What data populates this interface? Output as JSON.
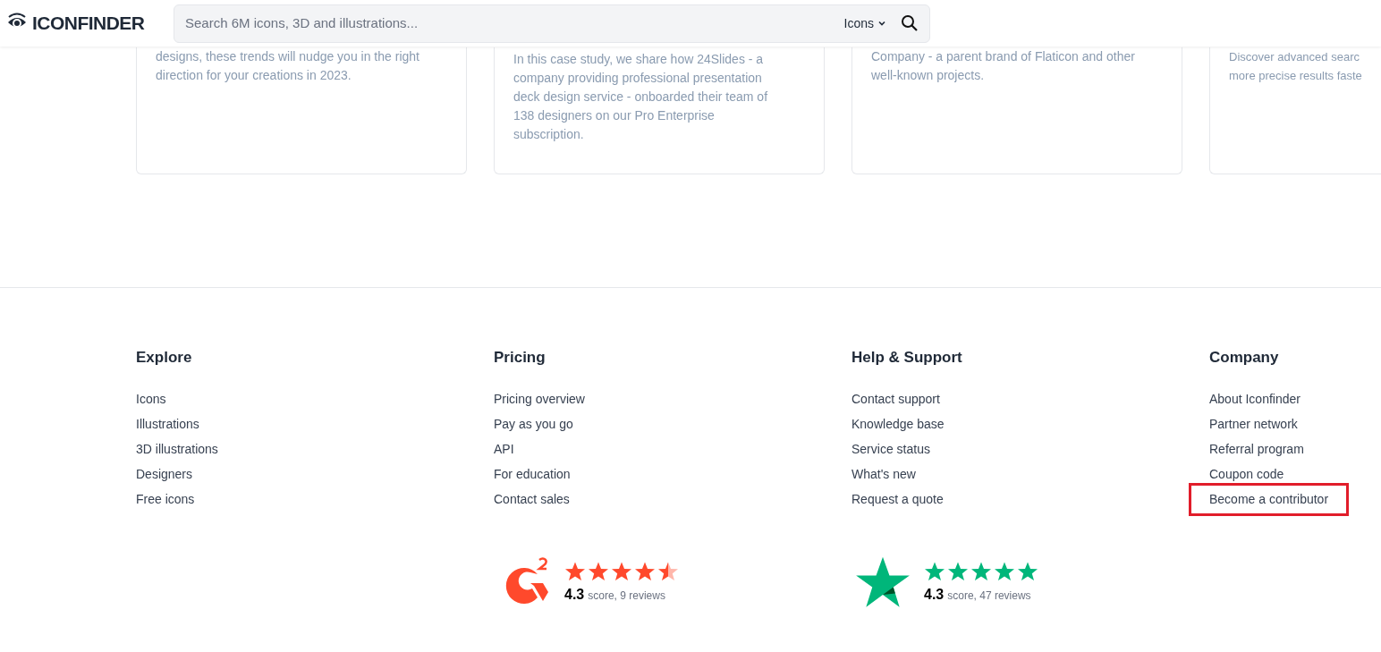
{
  "header": {
    "logo": "ICONFINDER",
    "search": {
      "placeholder": "Search 6M icons, 3D and illustrations...",
      "type_selector": "Icons"
    }
  },
  "cards": [
    {
      "lines": [
        "designs, these trends will nudge you in the right",
        "direction for your creations in 2023."
      ]
    },
    {
      "lines": [
        "In this case study, we share how 24Slides - a",
        "company providing professional presentation",
        "deck design service - onboarded their team of",
        "138 designers on our Pro Enterprise",
        "subscription."
      ]
    },
    {
      "lines": [
        "Company - a parent brand of Flaticon and other",
        "well-known projects."
      ]
    },
    {
      "lines": [
        "Discover advanced searc",
        "more precise results faste"
      ]
    }
  ],
  "footer_columns": [
    {
      "title": "Explore",
      "links": [
        {
          "label": "Icons",
          "highlighted": false
        },
        {
          "label": "Illustrations",
          "highlighted": false
        },
        {
          "label": "3D illustrations",
          "highlighted": false
        },
        {
          "label": "Designers",
          "highlighted": false
        },
        {
          "label": "Free icons",
          "highlighted": false
        }
      ]
    },
    {
      "title": "Pricing",
      "links": [
        {
          "label": "Pricing overview",
          "highlighted": false
        },
        {
          "label": "Pay as you go",
          "highlighted": false
        },
        {
          "label": "API",
          "highlighted": false
        },
        {
          "label": "For education",
          "highlighted": false
        },
        {
          "label": "Contact sales",
          "highlighted": false
        }
      ]
    },
    {
      "title": "Help & Support",
      "links": [
        {
          "label": "Contact support",
          "highlighted": false
        },
        {
          "label": "Knowledge base",
          "highlighted": false
        },
        {
          "label": "Service status",
          "highlighted": false
        },
        {
          "label": "What's new",
          "highlighted": false
        },
        {
          "label": "Request a quote",
          "highlighted": false
        }
      ]
    },
    {
      "title": "Company",
      "links": [
        {
          "label": "About Iconfinder",
          "highlighted": false
        },
        {
          "label": "Partner network",
          "highlighted": false
        },
        {
          "label": "Referral program",
          "highlighted": false
        },
        {
          "label": "Coupon code",
          "highlighted": false
        },
        {
          "label": "Become a contributor",
          "highlighted": true
        }
      ]
    }
  ],
  "ratings": [
    {
      "kind": "g2",
      "stars": 4.5,
      "score": "4.3",
      "detail": "score, 9 reviews",
      "color": "#ff492c"
    },
    {
      "kind": "trustpilot",
      "stars": 5,
      "score": "4.3",
      "detail": "score, 47 reviews",
      "color": "#00b67a"
    }
  ]
}
